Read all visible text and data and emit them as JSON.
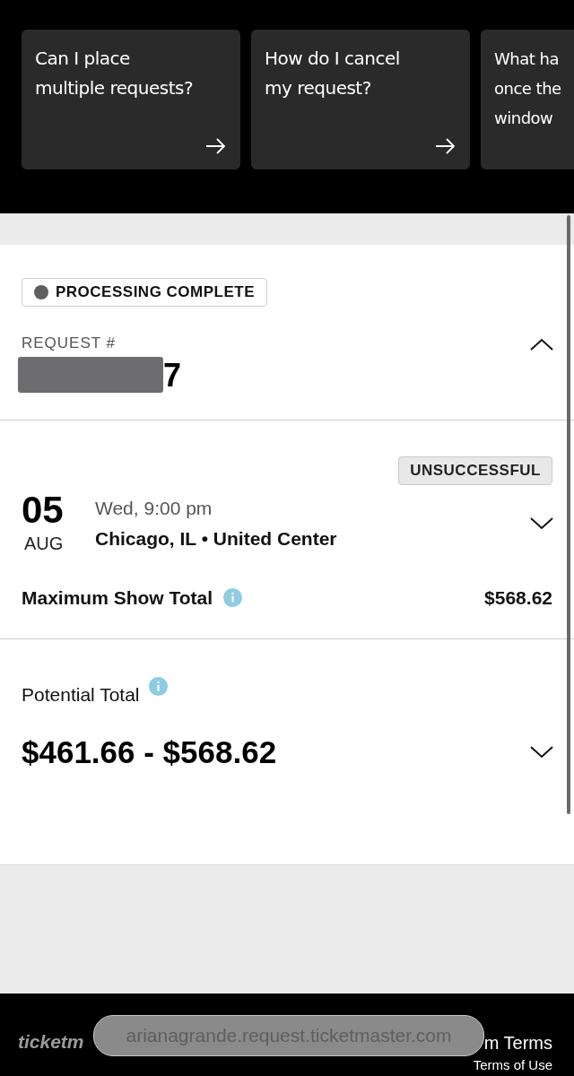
{
  "faq_cards": [
    {
      "question": "Can I place\nmultiple requests?",
      "arrow": true
    },
    {
      "question": "How do I cancel\nmy request?",
      "arrow": true
    },
    {
      "question": "What ha\nonce the\nwindow",
      "arrow": false
    }
  ],
  "request": {
    "status": "PROCESSING COMPLETE",
    "label": "REQUEST #",
    "number_visible": "7",
    "expanded": true
  },
  "event": {
    "result": "UNSUCCESSFUL",
    "day": "05",
    "month": "AUG",
    "time": "Wed, 9:00 pm",
    "venue": "Chicago, IL • United Center",
    "expanded": false,
    "max_label": "Maximum Show Total",
    "max_value": "$568.62"
  },
  "potential": {
    "label": "Potential Total",
    "range": "$461.66 - $568.62",
    "expanded": false
  },
  "footer": {
    "logo": "ticketm",
    "links": [
      "m Terms",
      "Terms of Use"
    ]
  },
  "url_bar": {
    "url": "arianagrande.request.ticketmaster.com"
  }
}
